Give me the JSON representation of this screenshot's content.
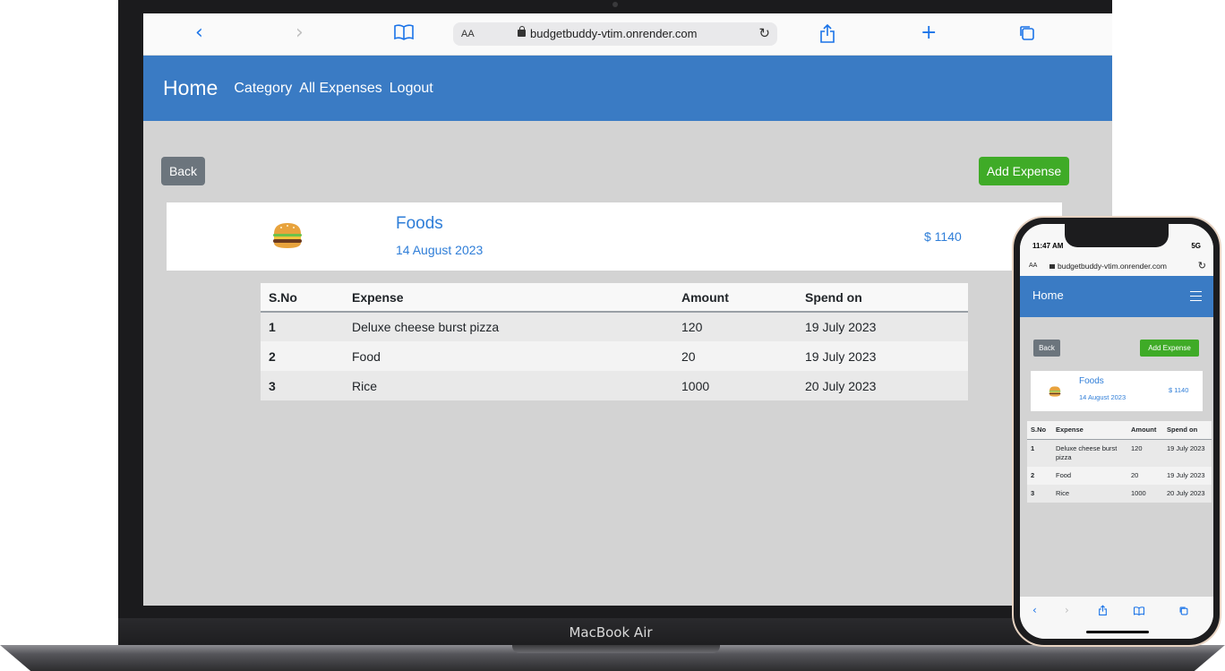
{
  "laptop": {
    "brand_label": "MacBook Air",
    "safari": {
      "url_aa": "AA",
      "url": "budgetbuddy-vtim.onrender.com",
      "icons": [
        "back-icon",
        "forward-icon",
        "bookmarks-icon",
        "lock-icon",
        "reload-icon",
        "share-icon",
        "new-tab-icon",
        "tabs-icon"
      ]
    },
    "nav": {
      "brand": "Home",
      "links": [
        "Category",
        "All Expenses",
        "Logout"
      ]
    },
    "back_label": "Back",
    "add_label": "Add Expense",
    "category": {
      "icon": "hamburger-emoji-icon",
      "name": "Foods",
      "date": "14 August 2023",
      "total": "$ 1140"
    },
    "table": {
      "headers": [
        "S.No",
        "Expense",
        "Amount",
        "Spend on"
      ],
      "rows": [
        [
          "1",
          "Deluxe cheese burst pizza",
          "120",
          "19 July 2023"
        ],
        [
          "2",
          "Food",
          "20",
          "19 July 2023"
        ],
        [
          "3",
          "Rice",
          "1000",
          "20 July 2023"
        ]
      ]
    }
  },
  "phone": {
    "status_time": "11:47 AM",
    "status_network": "5G",
    "url_aa": "AA",
    "url": "budgetbuddy-vtim.onrender.com",
    "nav_brand": "Home",
    "back_label": "Back",
    "add_label": "Add Expense",
    "category": {
      "name": "Foods",
      "date": "14 August 2023",
      "total": "$ 1140"
    },
    "table": {
      "headers": [
        "S.No",
        "Expense",
        "Amount",
        "Spend on"
      ],
      "rows": [
        [
          "1",
          "Deluxe cheese burst pizza",
          "120",
          "19 July 2023"
        ],
        [
          "2",
          "Food",
          "20",
          "19 July 2023"
        ],
        [
          "3",
          "Rice",
          "1000",
          "20 July 2023"
        ]
      ]
    }
  },
  "colors": {
    "nav_blue": "#3a7bc4",
    "add_green": "#3fab27",
    "back_gray": "#6c757d",
    "link_blue": "#2f7ed8",
    "page_bg": "#d3d3d3"
  }
}
